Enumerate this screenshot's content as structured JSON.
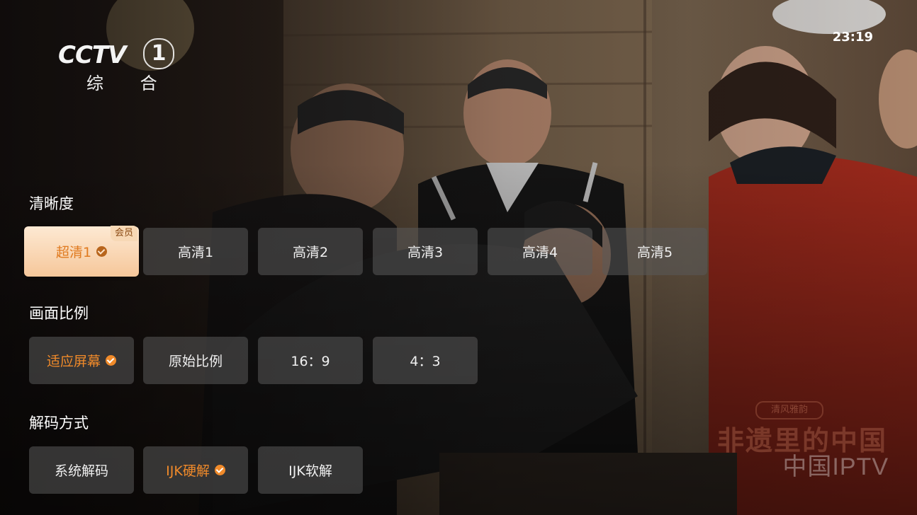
{
  "channel_logo": {
    "brand": "CCTV",
    "number": "1",
    "name": "综 合"
  },
  "clock": "23:19",
  "watermark": {
    "text": "中国IPTV",
    "program_title": "非遗里的中国",
    "badge": "清风雅韵"
  },
  "sections": {
    "resolution": {
      "title": "清晰度",
      "options": [
        {
          "label": "超清1",
          "state": "focused-selected",
          "tag": "会员"
        },
        {
          "label": "高清1"
        },
        {
          "label": "高清2"
        },
        {
          "label": "高清3"
        },
        {
          "label": "高清4"
        },
        {
          "label": "高清5"
        }
      ]
    },
    "aspect_ratio": {
      "title": "画面比例",
      "options": [
        {
          "label": "适应屏幕",
          "state": "selected"
        },
        {
          "label": "原始比例"
        },
        {
          "label": "16：9"
        },
        {
          "label": "4：3"
        }
      ]
    },
    "decoder": {
      "title": "解码方式",
      "options": [
        {
          "label": "系统解码"
        },
        {
          "label": "IJK硬解",
          "state": "selected"
        },
        {
          "label": "IJK软解"
        }
      ]
    }
  },
  "colors": {
    "accent": "#f08a2a",
    "focus_bg": "#f8d2ab",
    "option_bg": "#5a5a5a"
  }
}
